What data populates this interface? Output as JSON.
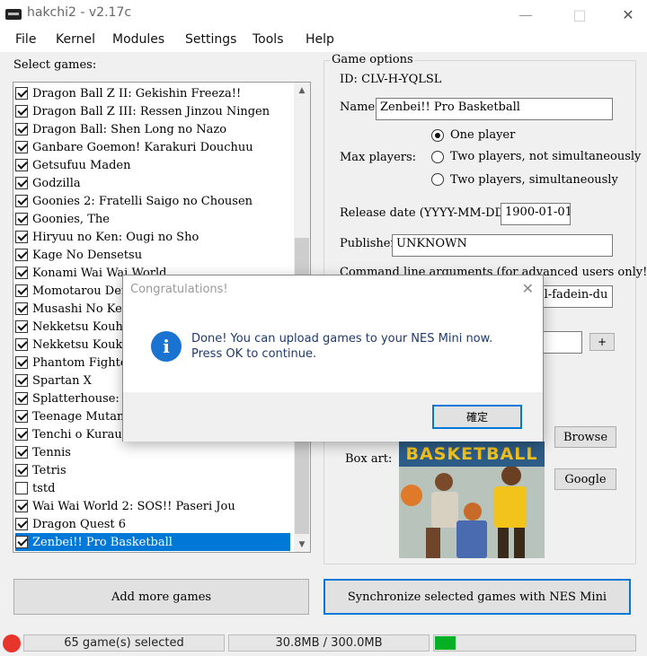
{
  "window": {
    "title": "hakchi2 - v2.17c"
  },
  "menu": [
    "File",
    "Kernel",
    "Modules",
    "Settings",
    "Tools",
    "Help"
  ],
  "games_panel": {
    "label": "Select games:",
    "games": [
      {
        "name": "Dragon Ball Z II: Gekishin Freeza!!",
        "checked": true
      },
      {
        "name": "Dragon Ball Z III: Ressen Jinzou Ningen",
        "checked": true
      },
      {
        "name": "Dragon Ball: Shen Long no Nazo",
        "checked": true
      },
      {
        "name": "Ganbare Goemon! Karakuri Douchuu",
        "checked": true
      },
      {
        "name": "Getsufuu Maden",
        "checked": true
      },
      {
        "name": "Godzilla",
        "checked": true
      },
      {
        "name": "Goonies 2: Fratelli Saigo no Chousen",
        "checked": true
      },
      {
        "name": "Goonies, The",
        "checked": true
      },
      {
        "name": "Hiryuu no Ken: Ougi no Sho",
        "checked": true
      },
      {
        "name": "Kage No Densetsu",
        "checked": true
      },
      {
        "name": "Konami Wai Wai World",
        "checked": true
      },
      {
        "name": "Momotarou Dente",
        "checked": true
      },
      {
        "name": "Musashi No Ken",
        "checked": true
      },
      {
        "name": "Nekketsu Kouha K",
        "checked": true
      },
      {
        "name": "Nekketsu Koukou",
        "checked": true
      },
      {
        "name": "Phantom Fighter",
        "checked": true
      },
      {
        "name": "Spartan X",
        "checked": true
      },
      {
        "name": "Splatterhouse: Wa",
        "checked": true
      },
      {
        "name": "Teenage Mutant N",
        "checked": true
      },
      {
        "name": "Tenchi o Kurau",
        "checked": true
      },
      {
        "name": "Tennis",
        "checked": true
      },
      {
        "name": "Tetris",
        "checked": true
      },
      {
        "name": "tstd",
        "checked": false
      },
      {
        "name": "Wai Wai World 2: SOS!! Paseri Jou",
        "checked": true
      },
      {
        "name": "Dragon Quest 6",
        "checked": true
      },
      {
        "name": "Zenbei!! Pro Basketball",
        "checked": true,
        "selected": true
      }
    ]
  },
  "game_options": {
    "group_label": "Game options",
    "id_text": "ID: CLV-H-YQLSL",
    "name_label": "Name:",
    "name_value": "Zenbei!! Pro Basketball",
    "max_players_label": "Max players:",
    "players": [
      {
        "label": "One player",
        "checked": true
      },
      {
        "label": "Two players, not simultaneously",
        "checked": false
      },
      {
        "label": "Two players, simultaneously",
        "checked": false
      }
    ],
    "release_label": "Release date (YYYY-MM-DD):",
    "release_value": "1900-01-01",
    "publisher_label": "Publisher:",
    "publisher_value": "UNKNOWN",
    "cmdline_label": "Command line arguments (for advanced users only!):",
    "cmdline_value": "--initial-fadein-du",
    "plus_label": "+",
    "browse_label": "Browse",
    "google_label": "Google",
    "boxart_label": "Box art:",
    "boxart_title": "BASKETBALL"
  },
  "buttons": {
    "add_games": "Add more games",
    "sync": "Synchronize selected games with NES Mini"
  },
  "status": {
    "selected_count": "65 game(s) selected",
    "size": "30.8MB / 300.0MB",
    "progress_fraction": 0.103
  },
  "dialog": {
    "title": "Congratulations!",
    "line1": "Done! You can upload games to your NES Mini now.",
    "line2": "Press OK to continue.",
    "ok": "確定",
    "icon": "info-icon"
  },
  "colors": {
    "accent": "#0078d7",
    "progress": "#06b025",
    "status_dot": "#e8352b",
    "dialog_text": "#1f3a6e"
  }
}
